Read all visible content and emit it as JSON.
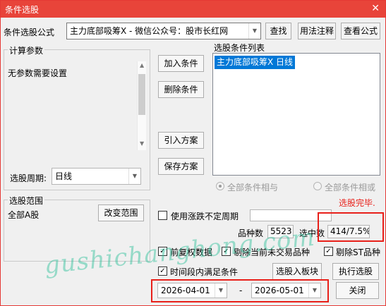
{
  "window": {
    "title": "条件选股",
    "close_glyph": "✕"
  },
  "formula": {
    "label": "条件选股公式",
    "value": "主力底部吸筹X  -  微信公众号：股市长红网",
    "buttons": {
      "search": "查找",
      "usage": "用法注释",
      "view": "查看公式"
    }
  },
  "params": {
    "group_label": "计算参数",
    "text": "无参数需要设置",
    "period_label": "选股周期:",
    "period_value": "日线"
  },
  "actions": {
    "add": "加入条件",
    "remove": "删除条件",
    "import": "引入方案",
    "save": "保存方案"
  },
  "conditions": {
    "label": "选股条件列表",
    "items": [
      "主力底部吸筹X  日线"
    ],
    "radio_and": "全部条件相与",
    "radio_or": "全部条件相或"
  },
  "status": {
    "text": "选股完毕.",
    "color": "#e8201a"
  },
  "scope": {
    "group_label": "选股范围",
    "text": "全部A股",
    "change_button": "改变范围"
  },
  "options": {
    "variable_period_label": "使用涨跌不定周期",
    "variable_period_checked": false,
    "variable_period_value": "",
    "prev_adjust_label": "前复权数据",
    "prev_adjust_checked": true,
    "exclude_untraded_label": "剔除当前未交易品种",
    "exclude_untraded_checked": true,
    "exclude_st_label": "剔除ST品种",
    "exclude_st_checked": true,
    "time_range_label": "时间段内满足条件",
    "time_range_checked": true,
    "checkmark": "✓"
  },
  "stats": {
    "count_label": "品种数",
    "count_value": "5523",
    "selected_label": "选中数",
    "selected_value": "414/7.5%"
  },
  "bottom": {
    "to_block": "选股入板块",
    "run": "执行选股",
    "date_from": "2026-04-01",
    "date_separator": "-",
    "date_to": "2026-05-01",
    "close": "关闭"
  },
  "watermark": "gushichanghong.com",
  "colors": {
    "titlebar": "#e8443a",
    "highlight": "#e8201a",
    "list_selection": "#0078d7"
  }
}
